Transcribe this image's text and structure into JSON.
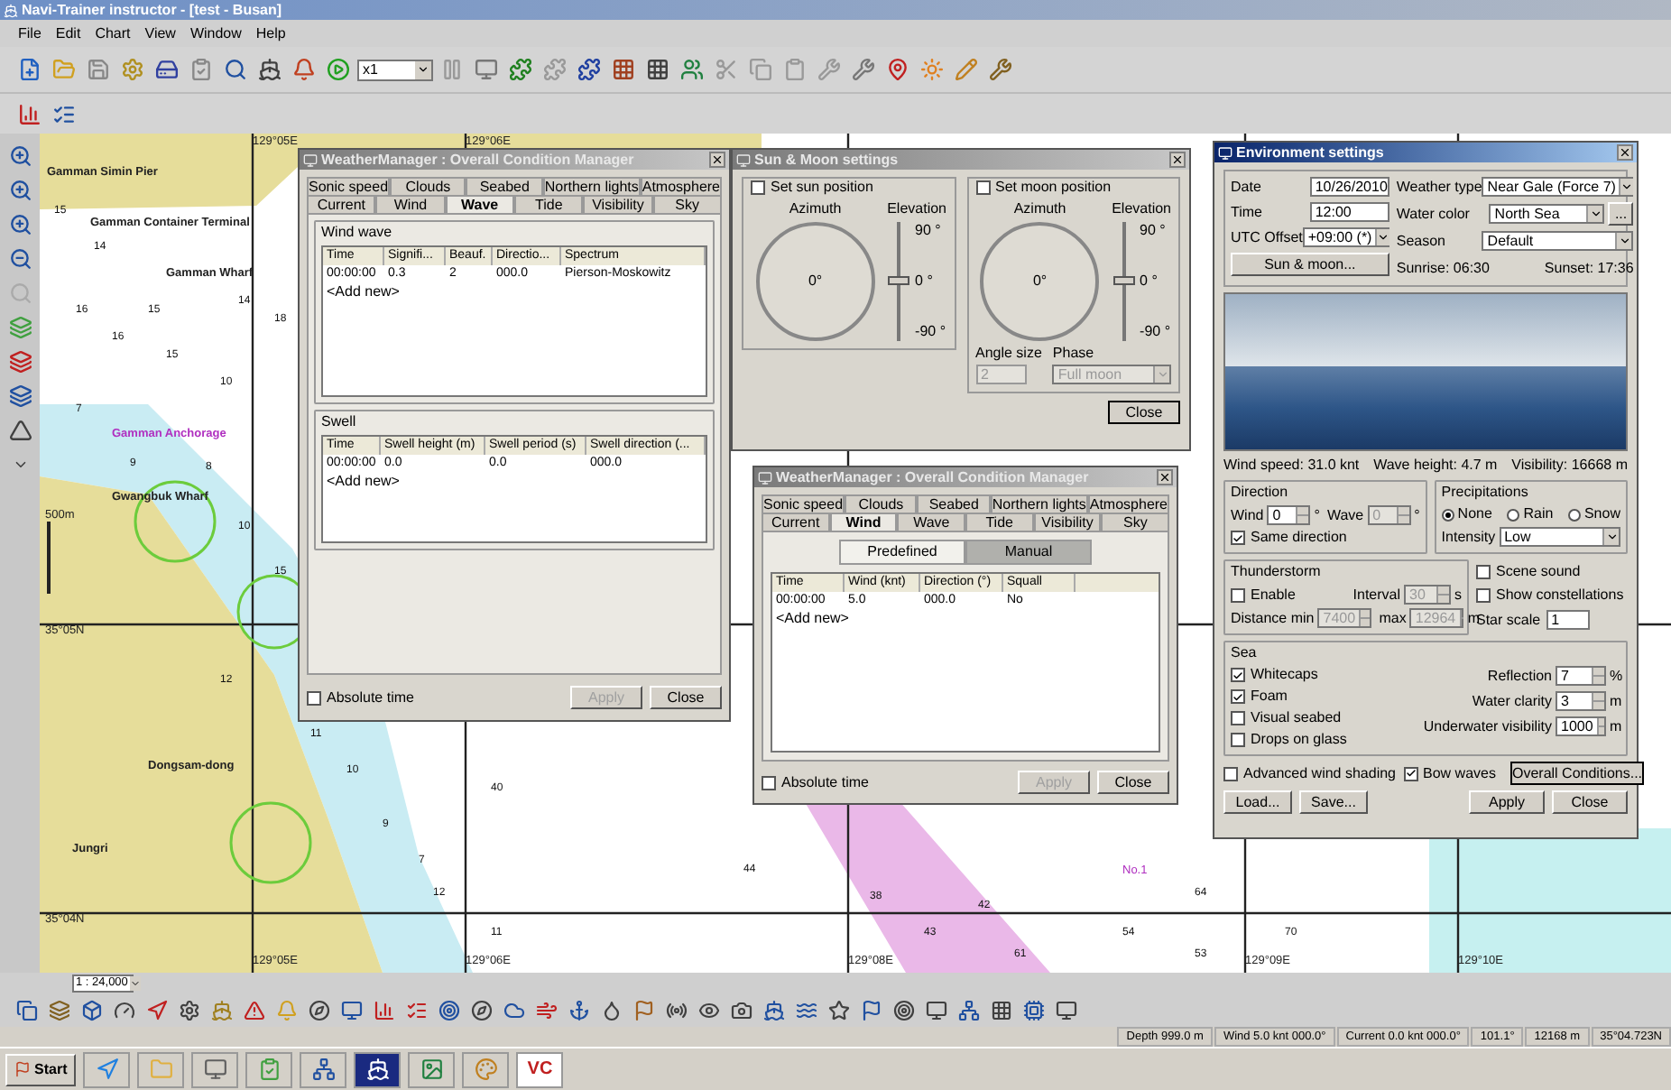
{
  "window": {
    "title": "Navi-Trainer instructor - [test - Busan]"
  },
  "menu": [
    "File",
    "Edit",
    "Chart",
    "View",
    "Window",
    "Help"
  ],
  "toolbar": {
    "speed": "x1"
  },
  "map": {
    "labels": [
      "Gamman Simin Pier",
      "Gamman Container Terminal",
      "Gamman Wharf",
      "Gamman Anchorage",
      "Gwangbuk Wharf",
      "500m",
      "35°05N",
      "Dongsam-dong",
      "Jungri",
      "35°04N",
      "129°05E",
      "129°06E",
      "129°05E",
      "129°06E",
      "129°08E",
      "129°09E",
      "129°10E",
      "No.1"
    ],
    "soundings": [
      "15",
      "14",
      "16",
      "15",
      "14",
      "18",
      "16",
      "15",
      "10",
      "7",
      "9",
      "8",
      "10",
      "15",
      "12",
      "11",
      "10",
      "9",
      "7",
      "12",
      "11",
      "44",
      "40",
      "38",
      "43",
      "42",
      "64",
      "70",
      "61",
      "54",
      "53"
    ],
    "scale": "1 : 24,000"
  },
  "wave_manager": {
    "title": "WeatherManager : Overall Condition Manager",
    "active": false,
    "tab_rows": [
      [
        {
          "label": "Sonic speed",
          "selected": false
        },
        {
          "label": "Clouds",
          "selected": false
        },
        {
          "label": "Seabed",
          "selected": false
        },
        {
          "label": "Northern lights",
          "selected": false
        },
        {
          "label": "Atmosphere",
          "selected": false
        }
      ],
      [
        {
          "label": "Current",
          "selected": false
        },
        {
          "label": "Wind",
          "selected": false
        },
        {
          "label": "Wave",
          "selected": true
        },
        {
          "label": "Tide",
          "selected": false
        },
        {
          "label": "Visibility",
          "selected": false
        },
        {
          "label": "Sky",
          "selected": false
        }
      ]
    ],
    "wind_wave": {
      "title": "Wind wave",
      "columns": [
        "Time",
        "Signifi...",
        "Beauf.",
        "Directio...",
        "Spectrum"
      ],
      "rows": [
        [
          "00:00:00",
          "0.3",
          "2",
          "000.0",
          "Pierson-Moskowitz"
        ]
      ],
      "add_new": "<Add new>"
    },
    "swell": {
      "title": "Swell",
      "columns": [
        "Time",
        "Swell height (m)",
        "Swell period (s)",
        "Swell direction (..."
      ],
      "rows": [
        [
          "00:00:00",
          "0.0",
          "0.0",
          "000.0"
        ]
      ],
      "add_new": "<Add new>"
    },
    "absolute_time": {
      "label": "Absolute time",
      "checked": false
    },
    "buttons": [
      {
        "label": "Apply",
        "disabled": true
      },
      {
        "label": "Close",
        "disabled": false
      }
    ]
  },
  "sun_moon": {
    "title": "Sun & Moon settings",
    "active": false,
    "panels": [
      {
        "label": "Set sun position",
        "checked": false,
        "azimuth_label": "Azimuth",
        "azimuth": "0°",
        "elevation_label": "Elevation",
        "ticks": [
          "90 °",
          "0 °",
          "-90 °"
        ],
        "level": 0.5
      },
      {
        "label": "Set moon position",
        "checked": false,
        "azimuth_label": "Azimuth",
        "azimuth": "0°",
        "elevation_label": "Elevation",
        "ticks": [
          "90 °",
          "0 °",
          "-90 °"
        ],
        "level": 0.5
      }
    ],
    "angle_size_label": "Angle size",
    "angle_size": "2",
    "phase_label": "Phase",
    "phase": "Full moon",
    "close": "Close"
  },
  "wind_manager": {
    "title": "WeatherManager : Overall Condition Manager",
    "active": false,
    "tab_rows": [
      [
        {
          "label": "Sonic speed",
          "selected": false
        },
        {
          "label": "Clouds",
          "selected": false
        },
        {
          "label": "Seabed",
          "selected": false
        },
        {
          "label": "Northern lights",
          "selected": false
        },
        {
          "label": "Atmosphere",
          "selected": false
        }
      ],
      [
        {
          "label": "Current",
          "selected": false
        },
        {
          "label": "Wind",
          "selected": true
        },
        {
          "label": "Wave",
          "selected": false
        },
        {
          "label": "Tide",
          "selected": false
        },
        {
          "label": "Visibility",
          "selected": false
        },
        {
          "label": "Sky",
          "selected": false
        }
      ]
    ],
    "modes": [
      {
        "label": "Predefined",
        "selected": false
      },
      {
        "label": "Manual",
        "selected": true
      }
    ],
    "columns": [
      "Time",
      "Wind (knt)",
      "Direction (°)",
      "Squall"
    ],
    "rows": [
      [
        "00:00:00",
        "5.0",
        "000.0",
        "No"
      ]
    ],
    "add_new": "<Add new>",
    "absolute_time": {
      "label": "Absolute time",
      "checked": false
    },
    "buttons": [
      {
        "label": "Apply",
        "disabled": true
      },
      {
        "label": "Close",
        "disabled": false
      }
    ]
  },
  "environment": {
    "title": "Environment settings",
    "active": true,
    "date_label": "Date",
    "date": "10/26/2010",
    "time_label": "Time",
    "time": "12:00",
    "utc_label": "UTC Offset",
    "utc": "+09:00 (*)",
    "weather_type_label": "Weather type",
    "weather_type": "Near Gale (Force 7)",
    "water_color_label": "Water color",
    "water_color": "North Sea",
    "more": "...",
    "season_label": "Season",
    "season": "Default",
    "sun_moon_button": "Sun & moon...",
    "sunrise": "Sunrise: 06:30",
    "sunset": "Sunset: 17:36",
    "stats": [
      "Wind speed: 31.0 knt",
      "Wave height: 4.7 m",
      "Visibility: 16668 m"
    ],
    "direction": {
      "title": "Direction",
      "wind_label": "Wind",
      "wind": "0",
      "wave_label": "Wave",
      "wave": "0",
      "wave_disabled": true,
      "unit": "°",
      "same": {
        "label": "Same direction",
        "checked": true
      }
    },
    "precipitations": {
      "title": "Precipitations",
      "options": [
        {
          "label": "None",
          "selected": true
        },
        {
          "label": "Rain",
          "selected": false
        },
        {
          "label": "Snow",
          "selected": false
        }
      ],
      "intensity_label": "Intensity",
      "intensity": "Low"
    },
    "thunderstorm": {
      "title": "Thunderstorm",
      "enable": {
        "label": "Enable",
        "checked": false
      },
      "interval_label": "Interval",
      "interval": "30",
      "interval_unit": "s",
      "min_label": "Distance min",
      "min": "7400",
      "max_label": "max",
      "max": "12964",
      "unit": "m",
      "disabled": true
    },
    "scene_sound": {
      "label": "Scene sound",
      "checked": false
    },
    "constellations": {
      "label": "Show constellations",
      "checked": false
    },
    "star_scale_label": "Star scale",
    "star_scale": "1",
    "sea": {
      "title": "Sea",
      "checks": [
        {
          "label": "Whitecaps",
          "checked": true
        },
        {
          "label": "Foam",
          "checked": true
        },
        {
          "label": "Visual seabed",
          "checked": false
        },
        {
          "label": "Drops on glass",
          "checked": false
        }
      ],
      "fields": [
        {
          "label": "Reflection",
          "value": "7",
          "unit": "%"
        },
        {
          "label": "Water clarity",
          "value": "3",
          "unit": "m"
        },
        {
          "label": "Underwater visibility",
          "value": "1000",
          "unit": "m"
        }
      ]
    },
    "advanced": {
      "label": "Advanced wind shading",
      "checked": false
    },
    "bow_waves": {
      "label": "Bow waves",
      "checked": true
    },
    "overall": "Overall Conditions...",
    "buttons": [
      "Load...",
      "Save...",
      "Apply",
      "Close"
    ]
  },
  "status_bar": [
    "Depth 999.0 m",
    "Wind 5.0 knt 000.0°",
    "Current 0.0 knt 000.0°",
    "101.1°",
    "12168 m",
    "35°04.723N"
  ],
  "taskbar": {
    "start": "Start",
    "logo": "VC"
  }
}
